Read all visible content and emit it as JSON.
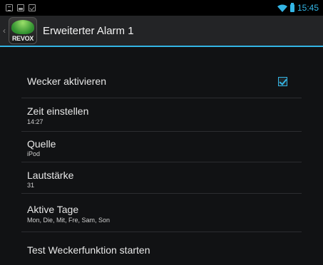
{
  "status_bar": {
    "time": "15:45",
    "left_icons": [
      "notification-icon",
      "image-icon",
      "checklist-icon"
    ],
    "right_icons": [
      "wifi-icon",
      "battery-icon"
    ]
  },
  "action_bar": {
    "app_logo_text": "REVOX",
    "title": "Erweiterter Alarm 1"
  },
  "settings": {
    "items": [
      {
        "title": "Wecker aktivieren",
        "summary": "",
        "checked": true
      },
      {
        "title": "Zeit einstellen",
        "summary": "14:27"
      },
      {
        "title": "Quelle",
        "summary": "iPod"
      },
      {
        "title": "Lautstärke",
        "summary": "31"
      },
      {
        "title": "Aktive Tage",
        "summary": "Mon, Die, Mit, Fre, Sam, Son"
      },
      {
        "title": "Test Weckerfunktion starten",
        "summary": ""
      }
    ]
  },
  "colors": {
    "accent": "#33b5e5",
    "background": "#111214",
    "action_bar": "#232426"
  }
}
